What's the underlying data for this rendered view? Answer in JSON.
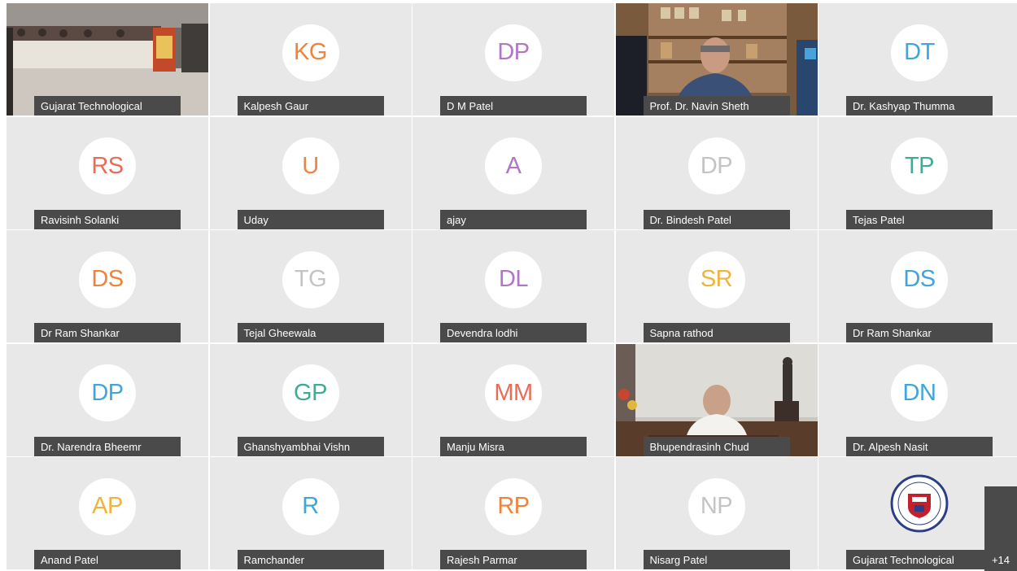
{
  "participants": [
    {
      "type": "video",
      "scene": "conference-room",
      "name": "Gujarat Technological"
    },
    {
      "type": "initials",
      "initials": "KG",
      "color": "#f0833a",
      "name": "Kalpesh Gaur"
    },
    {
      "type": "initials",
      "initials": "DP",
      "color": "#b176c4",
      "name": "D M Patel"
    },
    {
      "type": "video",
      "scene": "office-shelf",
      "name": "Prof. Dr. Navin Sheth"
    },
    {
      "type": "initials",
      "initials": "DT",
      "color": "#3ea6dd",
      "name": "Dr. Kashyap Thumma"
    },
    {
      "type": "initials",
      "initials": "RS",
      "color": "#ea6c58",
      "name": "Ravisinh Solanki"
    },
    {
      "type": "initials",
      "initials": "U",
      "color": "#f0833a",
      "name": "Uday"
    },
    {
      "type": "initials",
      "initials": "A",
      "color": "#b176c4",
      "name": "ajay"
    },
    {
      "type": "initials",
      "initials": "DP",
      "color": "#c4c4c4",
      "name": "Dr. Bindesh Patel"
    },
    {
      "type": "initials",
      "initials": "TP",
      "color": "#3eab94",
      "name": "Tejas Patel"
    },
    {
      "type": "initials",
      "initials": "DS",
      "color": "#f0833a",
      "name": "Dr Ram Shankar"
    },
    {
      "type": "initials",
      "initials": "TG",
      "color": "#c4c4c4",
      "name": "Tejal Gheewala"
    },
    {
      "type": "initials",
      "initials": "DL",
      "color": "#b176c4",
      "name": "Devendra lodhi"
    },
    {
      "type": "initials",
      "initials": "SR",
      "color": "#f0b43a",
      "name": "Sapna rathod"
    },
    {
      "type": "initials",
      "initials": "DS",
      "color": "#3ea6dd",
      "name": "Dr Ram Shankar"
    },
    {
      "type": "initials",
      "initials": "DP",
      "color": "#3ea6dd",
      "name": "Dr. Narendra Bheemr"
    },
    {
      "type": "initials",
      "initials": "GP",
      "color": "#3eab94",
      "name": "Ghanshyambhai Vishn"
    },
    {
      "type": "initials",
      "initials": "MM",
      "color": "#ea6c58",
      "name": "Manju Misra"
    },
    {
      "type": "video",
      "scene": "office-statue",
      "name": "Bhupendrasinh Chud"
    },
    {
      "type": "initials",
      "initials": "DN",
      "color": "#3ea6dd",
      "name": "Dr. Alpesh Nasit"
    },
    {
      "type": "initials",
      "initials": "AP",
      "color": "#f0b43a",
      "name": "Anand Patel"
    },
    {
      "type": "initials",
      "initials": "R",
      "color": "#3ea6dd",
      "name": "Ramchander"
    },
    {
      "type": "initials",
      "initials": "RP",
      "color": "#f0833a",
      "name": "Rajesh Parmar"
    },
    {
      "type": "initials",
      "initials": "NP",
      "color": "#c4c4c4",
      "name": "Nisarg Patel"
    },
    {
      "type": "logo",
      "name": "Gujarat Technological"
    }
  ],
  "more_button": {
    "label": "+14"
  }
}
